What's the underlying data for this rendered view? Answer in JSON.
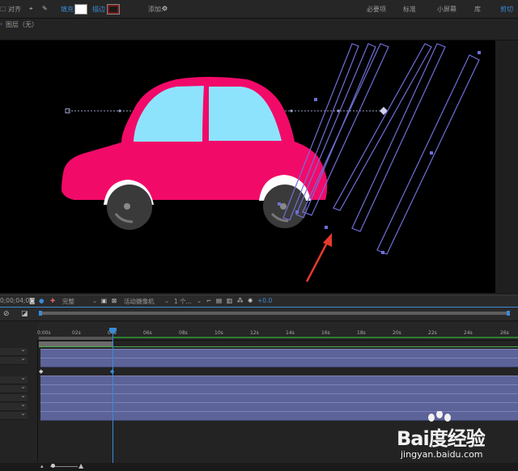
{
  "toolbar": {
    "align_label": "对齐",
    "fill_label": "填充",
    "stroke_label": "描边",
    "add_label": "添加:",
    "workspaces": [
      "必要项",
      "标准",
      "小屏幕",
      "库",
      "剪切"
    ],
    "fill_color": "#ffffff",
    "stroke_color": "#7a1a1a"
  },
  "crumb": {
    "layer_label": "图层（无）"
  },
  "viewer_bar": {
    "timecode": "0;00;04;01",
    "quality": "完整",
    "camera": "活动摄像机",
    "views": "1 个...",
    "exposure": "+0.0"
  },
  "ruler": {
    "ticks": [
      "0:00s",
      "02s",
      "04s",
      "06s",
      "08s",
      "10s",
      "12s",
      "14s",
      "16s",
      "18s",
      "20s",
      "22s",
      "24s",
      "26s"
    ]
  },
  "watermark": {
    "brand": "Bai度经验",
    "url": "jingyan.baidu.com"
  },
  "colors": {
    "car_body": "#f20a69",
    "window": "#8ee3fc",
    "wheel": "#3a3a3a",
    "accent": "#3a8bd6",
    "track": "#5c6398",
    "mask_outline": "#6f6fd8",
    "arrow": "#e53a2c"
  }
}
